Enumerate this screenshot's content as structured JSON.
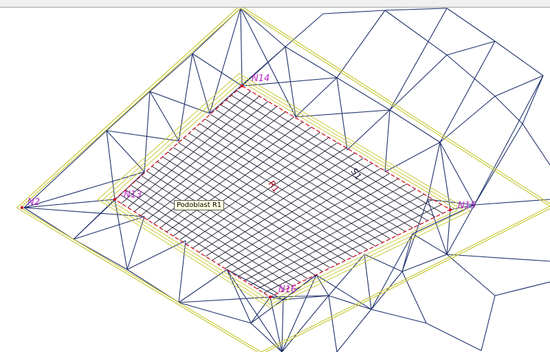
{
  "viewport": {
    "colors": {
      "mesh": "#1d2f6b",
      "slab_outline": "#c8c83c",
      "region_outline": "#d01020",
      "node_label": "#b424c8",
      "background": "#ffffff"
    }
  },
  "nodes": [
    {
      "id": "n2",
      "label": "N2"
    },
    {
      "id": "n13",
      "label": "N13"
    },
    {
      "id": "n14",
      "label": "N14"
    },
    {
      "id": "n15",
      "label": "N15"
    },
    {
      "id": "n16",
      "label": "N16"
    }
  ],
  "region_label": "R1",
  "surface_label": "S1",
  "tooltip": {
    "text": "Podoblast R1"
  }
}
